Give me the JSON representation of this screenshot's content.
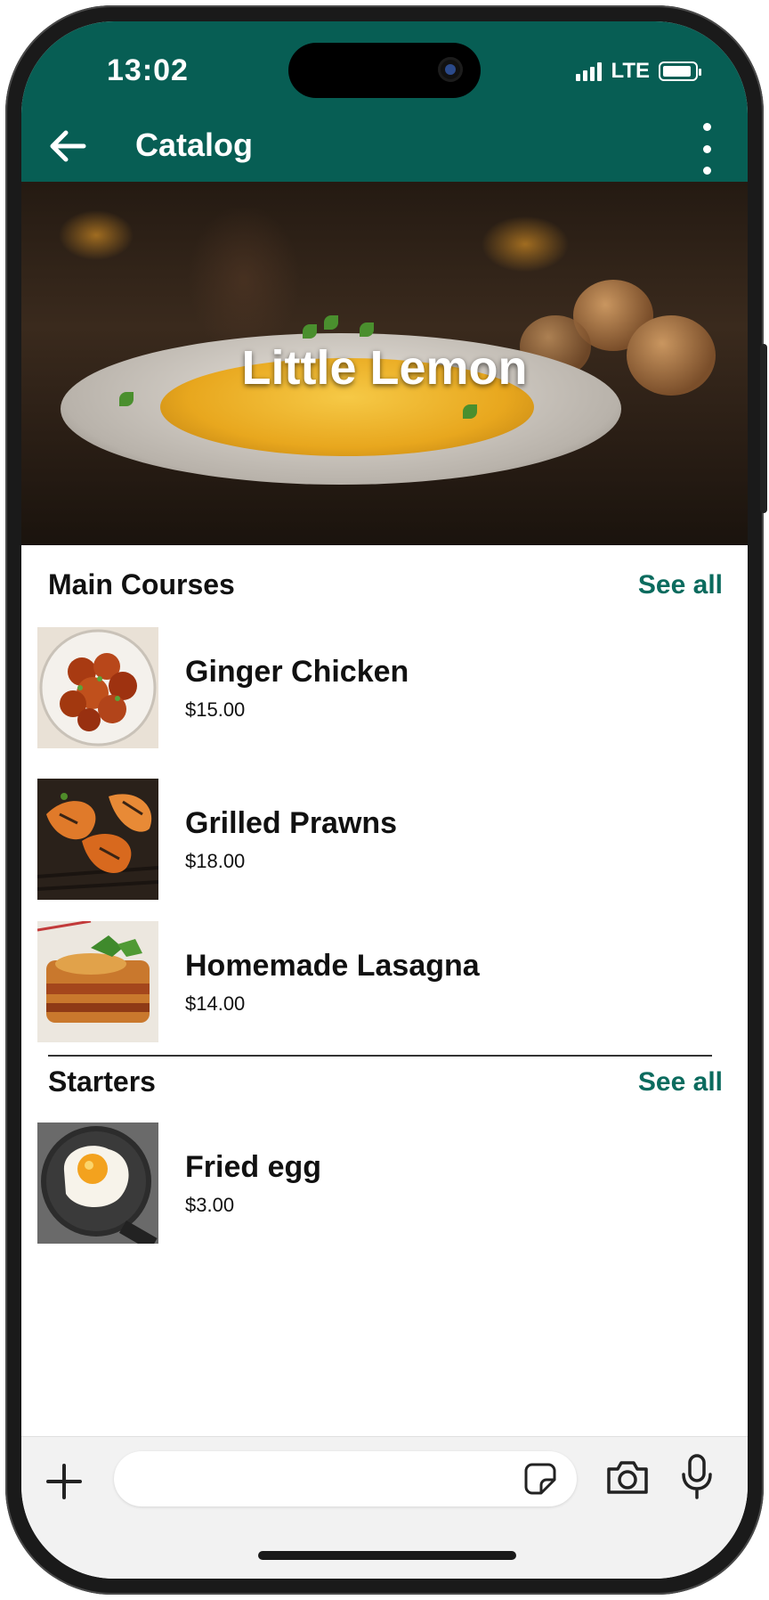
{
  "status_bar": {
    "time": "13:02",
    "network": "LTE"
  },
  "header": {
    "title": "Catalog"
  },
  "hero": {
    "title": "Little Lemon"
  },
  "sections": [
    {
      "title": "Main Courses",
      "see_all": "See all",
      "items": [
        {
          "name": "Ginger Chicken",
          "price": "$15.00"
        },
        {
          "name": "Grilled Prawns",
          "price": "$18.00"
        },
        {
          "name": "Homemade Lasagna",
          "price": "$14.00"
        }
      ]
    },
    {
      "title": "Starters",
      "see_all": "See all",
      "items": [
        {
          "name": "Fried egg",
          "price": "$3.00"
        }
      ]
    }
  ],
  "composer": {
    "placeholder": ""
  },
  "colors": {
    "brand": "#075e54",
    "accent": "#0b6b5e"
  },
  "icons": [
    "back-arrow-icon",
    "more-vertical-icon",
    "plus-icon",
    "sticker-icon",
    "camera-icon",
    "microphone-icon"
  ]
}
